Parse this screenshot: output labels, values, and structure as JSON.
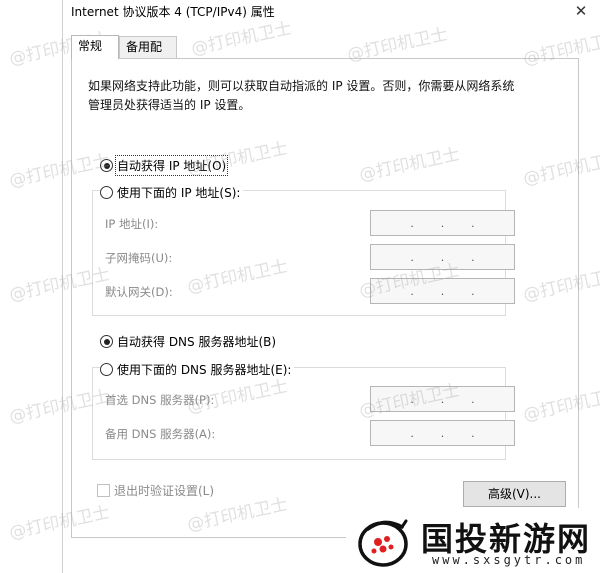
{
  "window": {
    "title": "Internet 协议版本 4 (TCP/IPv4) 属性",
    "close_symbol": "✕"
  },
  "tabs": [
    {
      "label": "常规",
      "active": true
    },
    {
      "label": "备用配置",
      "active": false
    }
  ],
  "description": "如果网络支持此功能，则可以获取自动指派的 IP 设置。否则，你需要从网络系统管理员处获得适当的 IP 设置。",
  "ip_section": {
    "auto_option": "自动获得 IP 地址(O)",
    "manual_option": "使用下面的 IP 地址(S):",
    "auto_selected": true,
    "fields": [
      {
        "label": "IP 地址(I):",
        "value": ". . ."
      },
      {
        "label": "子网掩码(U):",
        "value": ". . ."
      },
      {
        "label": "默认网关(D):",
        "value": ". . ."
      }
    ]
  },
  "dns_section": {
    "auto_option": "自动获得 DNS 服务器地址(B)",
    "manual_option": "使用下面的 DNS 服务器地址(E):",
    "auto_selected": true,
    "fields": [
      {
        "label": "首选 DNS 服务器(P):",
        "value": ". . ."
      },
      {
        "label": "备用 DNS 服务器(A):",
        "value": ". . ."
      }
    ]
  },
  "validate_checkbox": {
    "label": "退出时验证设置(L)",
    "checked": false
  },
  "buttons": {
    "advanced": "高级(V)..."
  },
  "watermark": {
    "text": "@打印机卫士"
  },
  "brand": {
    "name": "国投新游网",
    "url": "www.sxsgytr.com"
  },
  "colors": {
    "focus_blue": "#0078d7",
    "disabled_text": "#8a8a8a"
  }
}
